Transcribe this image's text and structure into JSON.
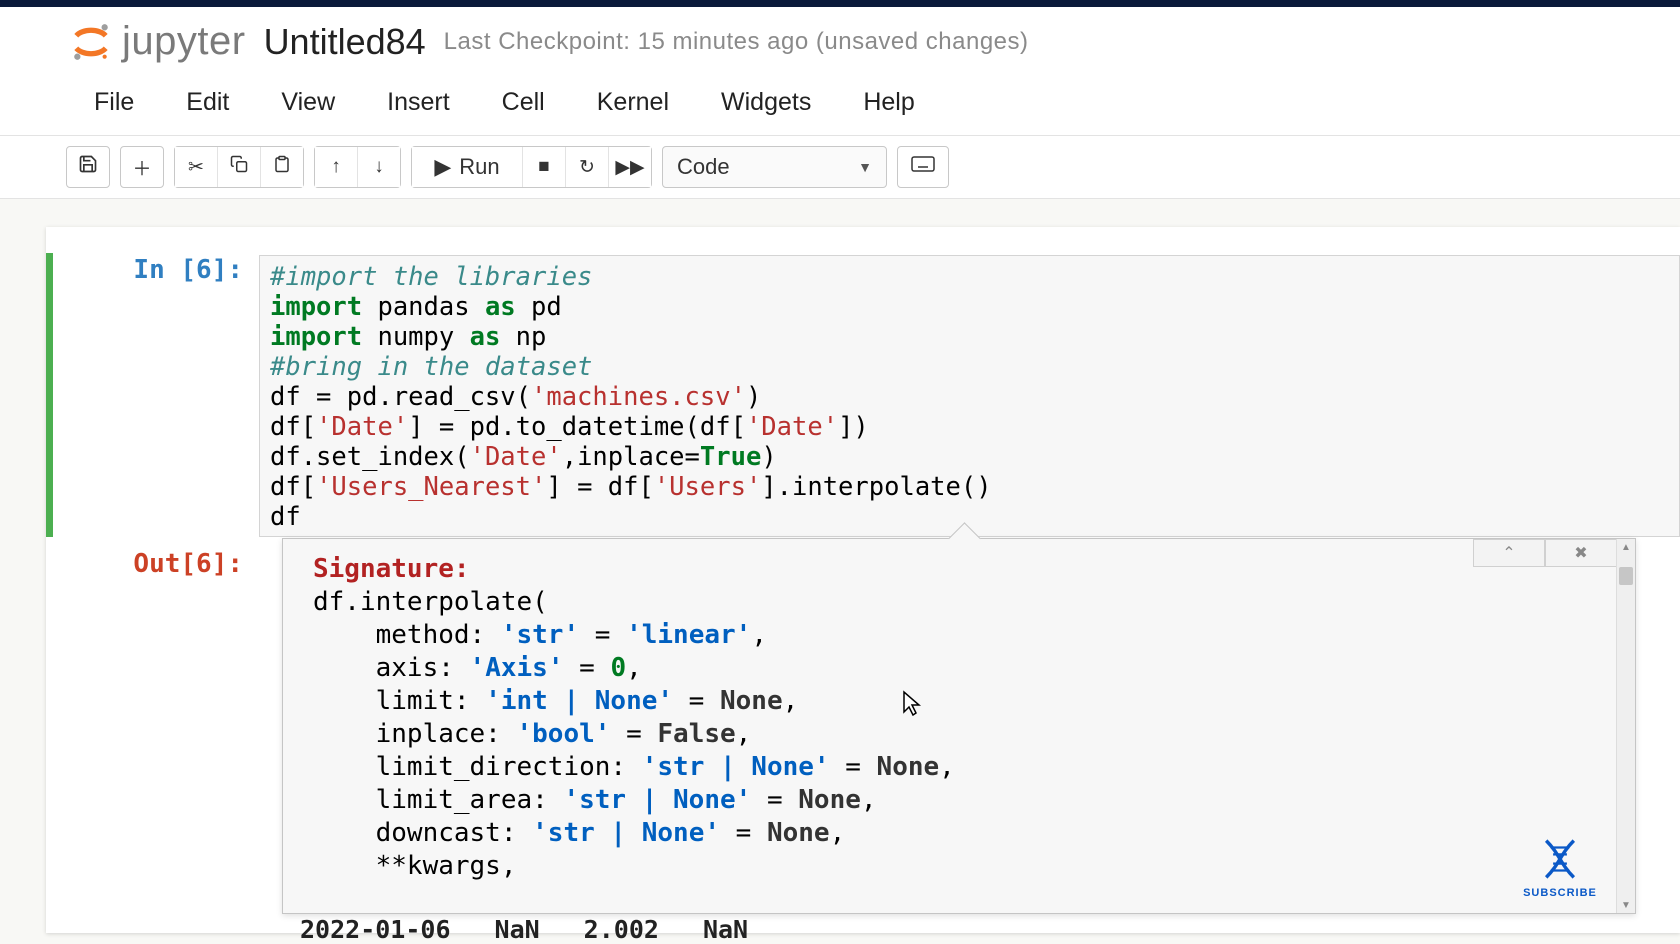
{
  "logo_text": "jupyter",
  "title": "Untitled84",
  "checkpoint": "Last Checkpoint: 15 minutes ago  (unsaved changes)",
  "menu": [
    "File",
    "Edit",
    "View",
    "Insert",
    "Cell",
    "Kernel",
    "Widgets",
    "Help"
  ],
  "toolbar": {
    "run_label": "Run",
    "cell_type": "Code"
  },
  "cell": {
    "in_prompt": "In [6]:",
    "out_prompt": "Out[6]:",
    "code_lines": [
      [
        [
          "comment",
          "#import the libraries"
        ]
      ],
      [
        [
          "kw",
          "import"
        ],
        [
          "plain",
          " pandas "
        ],
        [
          "kw",
          "as"
        ],
        [
          "plain",
          " pd"
        ]
      ],
      [
        [
          "kw",
          "import"
        ],
        [
          "plain",
          " numpy "
        ],
        [
          "kw",
          "as"
        ],
        [
          "plain",
          " np"
        ]
      ],
      [
        [
          "comment",
          "#bring in the dataset"
        ]
      ],
      [
        [
          "plain",
          "df = pd.read_csv("
        ],
        [
          "str",
          "'machines.csv'"
        ],
        [
          "plain",
          ")"
        ]
      ],
      [
        [
          "plain",
          "df["
        ],
        [
          "str",
          "'Date'"
        ],
        [
          "plain",
          "] = pd.to_datetime(df["
        ],
        [
          "str",
          "'Date'"
        ],
        [
          "plain",
          "])"
        ]
      ],
      [
        [
          "plain",
          "df.set_index("
        ],
        [
          "str",
          "'Date'"
        ],
        [
          "plain",
          ",inplace="
        ],
        [
          "bool",
          "True"
        ],
        [
          "plain",
          ")"
        ]
      ],
      [
        [
          "plain",
          "df["
        ],
        [
          "str",
          "'Users_Nearest'"
        ],
        [
          "plain",
          "] = df["
        ],
        [
          "str",
          "'Users'"
        ],
        [
          "plain",
          "].interpolate()"
        ]
      ],
      [
        [
          "plain",
          "df"
        ]
      ]
    ]
  },
  "help": {
    "signature_label": "Signature:",
    "call": "df.interpolate(",
    "params": [
      {
        "name": "method",
        "type": "'str'",
        "default": "'linear'",
        "default_kind": "str"
      },
      {
        "name": "axis",
        "type": "'Axis'",
        "default": "0",
        "default_kind": "num"
      },
      {
        "name": "limit",
        "type": "'int | None'",
        "default": "None",
        "default_kind": "none"
      },
      {
        "name": "inplace",
        "type": "'bool'",
        "default": "False",
        "default_kind": "none"
      },
      {
        "name": "limit_direction",
        "type": "'str | None'",
        "default": "None",
        "default_kind": "none"
      },
      {
        "name": "limit_area",
        "type": "'str | None'",
        "default": "None",
        "default_kind": "none"
      },
      {
        "name": "downcast",
        "type": "'str | None'",
        "default": "None",
        "default_kind": "none"
      }
    ],
    "kwargs": "**kwargs,"
  },
  "out_peek": [
    "2022-01-06",
    "NaN",
    "2.002",
    "NaN"
  ],
  "subscribe": "SUBSCRIBE"
}
